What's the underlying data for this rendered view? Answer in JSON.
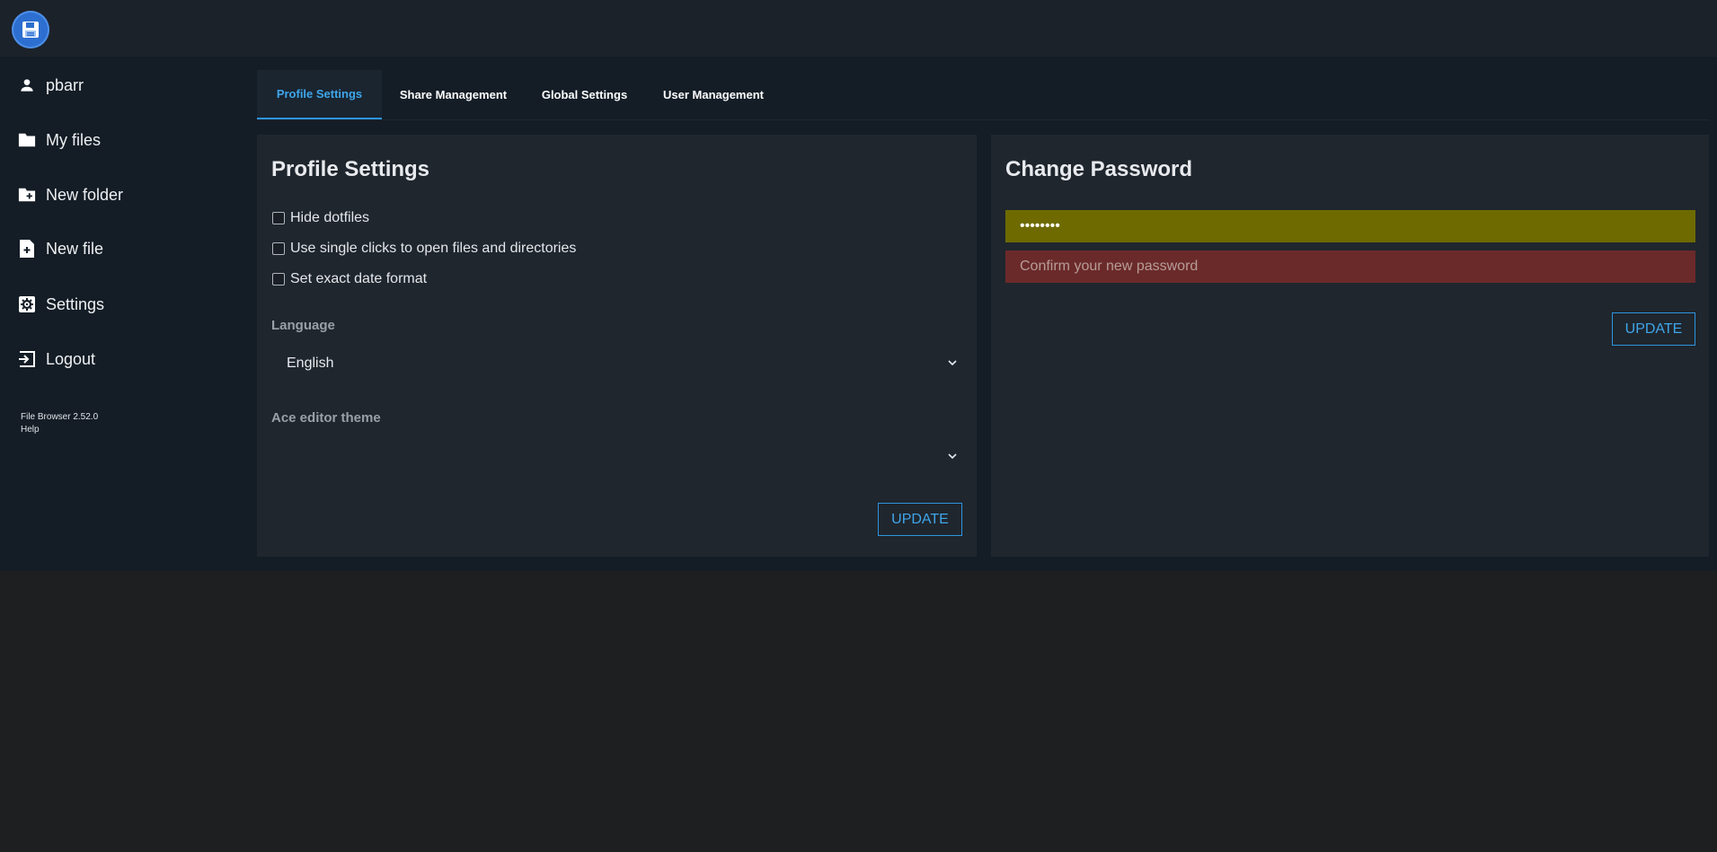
{
  "app": {
    "logo_icon": "floppy-disk-icon",
    "accent_color": "#2d95e0"
  },
  "sidebar": {
    "items": [
      {
        "label": "pbarr",
        "icon": "user-icon"
      },
      {
        "label": "My files",
        "icon": "folder-icon"
      },
      {
        "label": "New folder",
        "icon": "new-folder-icon"
      },
      {
        "label": "New file",
        "icon": "new-file-icon"
      },
      {
        "label": "Settings",
        "icon": "settings-icon"
      },
      {
        "label": "Logout",
        "icon": "logout-icon"
      }
    ],
    "version": "File Browser 2.52.0",
    "help": "Help"
  },
  "tabs": [
    {
      "label": "Profile Settings",
      "active": true
    },
    {
      "label": "Share Management",
      "active": false
    },
    {
      "label": "Global Settings",
      "active": false
    },
    {
      "label": "User Management",
      "active": false
    }
  ],
  "profile": {
    "title": "Profile Settings",
    "options": [
      {
        "label": "Hide dotfiles",
        "checked": false
      },
      {
        "label": "Use single clicks to open files and directories",
        "checked": false
      },
      {
        "label": "Set exact date format",
        "checked": false
      }
    ],
    "language_label": "Language",
    "language_value": "English",
    "ace_label": "Ace editor theme",
    "ace_value": "",
    "update_label": "UPDATE"
  },
  "password": {
    "title": "Change Password",
    "new_value": "••••••••",
    "confirm_placeholder": "Confirm your new password",
    "update_label": "UPDATE",
    "new_bg": "#6e6a00",
    "confirm_bg": "#6b2a2a"
  }
}
